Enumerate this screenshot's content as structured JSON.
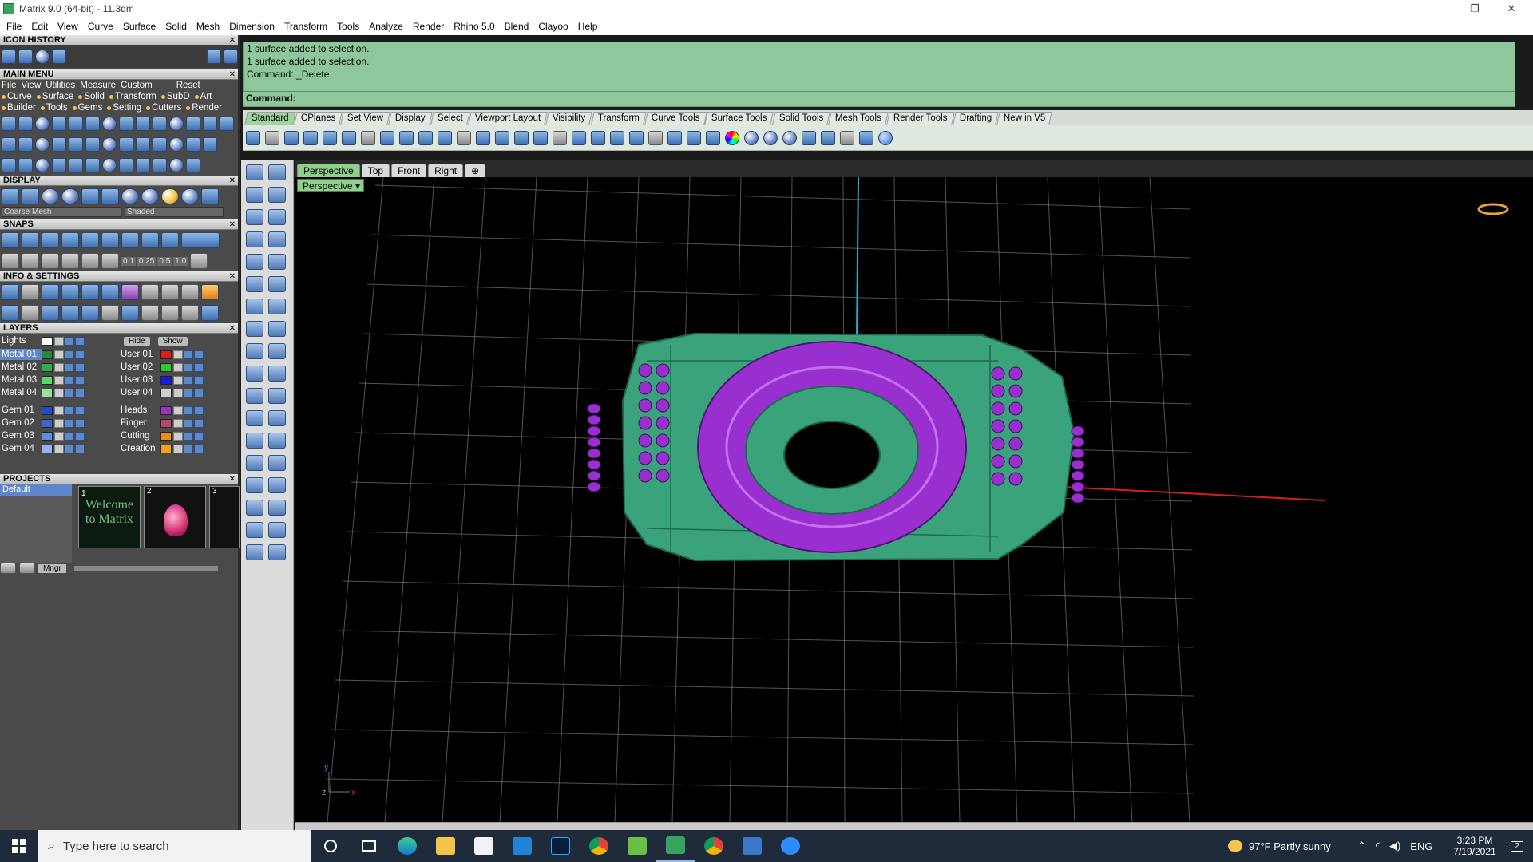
{
  "window": {
    "title": "Matrix 9.0 (64-bit) - 11.3dm",
    "minimize": "—",
    "restore": "❐",
    "close": "✕"
  },
  "menubar": [
    "File",
    "Edit",
    "View",
    "Curve",
    "Surface",
    "Solid",
    "Mesh",
    "Dimension",
    "Transform",
    "Tools",
    "Analyze",
    "Render",
    "Rhino 5.0",
    "Blend",
    "Clayoo",
    "Help"
  ],
  "panels": {
    "icon_history": {
      "title": "ICON HISTORY",
      "close": "✕"
    },
    "main_menu": {
      "title": "MAIN MENU",
      "close": "✕",
      "row1": [
        "File",
        "View",
        "Utilities",
        "Measure",
        "Custom",
        "Reset"
      ],
      "row2": [
        "Curve",
        "Surface",
        "Solid",
        "Transform",
        "SubD",
        "Art"
      ],
      "row3": [
        "Builder",
        "Tools",
        "Gems",
        "Setting",
        "Cutters",
        "Render"
      ]
    },
    "display": {
      "title": "DISPLAY",
      "close": "✕",
      "mesh_select": "Coarse Mesh",
      "shade_select": "Shaded"
    },
    "snaps": {
      "title": "SNAPS",
      "close": "✕",
      "values": [
        "0.1",
        "0.25",
        "0.5",
        "1.0"
      ]
    },
    "info_settings": {
      "title": "INFO & SETTINGS",
      "close": "✕"
    },
    "layers": {
      "title": "LAYERS",
      "close": "✕",
      "lights": "Lights",
      "hide": "Hide",
      "show": "Show",
      "left_rows": [
        {
          "name": "Metal 01",
          "color": "#1f8a3a"
        },
        {
          "name": "Metal 02",
          "color": "#2fae4c"
        },
        {
          "name": "Metal 03",
          "color": "#5ed36a"
        },
        {
          "name": "Metal 04",
          "color": "#98e39a"
        },
        {
          "name": "Gem 01",
          "color": "#1c4fc4"
        },
        {
          "name": "Gem 02",
          "color": "#3569d1"
        },
        {
          "name": "Gem 03",
          "color": "#5d8ee0"
        },
        {
          "name": "Gem 04",
          "color": "#8fb4ef"
        }
      ],
      "right_rows": [
        {
          "name": "User 01",
          "color": "#e11b1b"
        },
        {
          "name": "User 02",
          "color": "#2acb2a"
        },
        {
          "name": "User 03",
          "color": "#1a1ae0"
        },
        {
          "name": "User 04",
          "color": "#cfcfcf"
        },
        {
          "name": "Heads",
          "color": "#9b33c9"
        },
        {
          "name": "Finger",
          "color": "#b8456a"
        },
        {
          "name": "Cutting",
          "color": "#f08a16"
        },
        {
          "name": "Creation",
          "color": "#f2a11a"
        }
      ]
    },
    "projects": {
      "title": "PROJECTS",
      "close": "✕",
      "default": "Default",
      "thumbs": [
        "1",
        "2",
        "3"
      ],
      "welcome": "Welcome to Matrix",
      "mngr": "Mngr"
    }
  },
  "command": {
    "history": [
      "1 surface added to selection.",
      "1 surface added to selection.",
      "Command: _Delete"
    ],
    "prompt": "Command:"
  },
  "toolbar_tabs": [
    "Standard",
    "CPlanes",
    "Set View",
    "Display",
    "Select",
    "Viewport Layout",
    "Visibility",
    "Transform",
    "Curve Tools",
    "Surface Tools",
    "Solid Tools",
    "Mesh Tools",
    "Render Tools",
    "Drafting",
    "New in V5"
  ],
  "active_tab": "Standard",
  "viewport_tabs": [
    "Perspective",
    "Top",
    "Front",
    "Right",
    "⊕"
  ],
  "viewport_label": "Perspective ▾",
  "axis": {
    "y": "y",
    "z": "z",
    "x": "x"
  },
  "colors": {
    "command_bg": "#8ec89a",
    "model_green": "#3aa37c",
    "model_purple": "#9a2fd0",
    "grid": "#8a8a8a"
  },
  "taskbar": {
    "search_placeholder": "Type here to search",
    "weather": "97°F  Partly sunny",
    "lang": "ENG",
    "time": "3:23 PM",
    "date": "7/19/2021",
    "notifications": "2"
  }
}
